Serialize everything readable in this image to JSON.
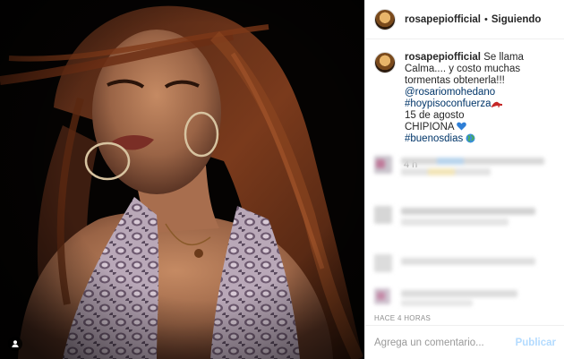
{
  "post": {
    "author": "rosapepiofficial",
    "separator": "•",
    "follow_status": "Siguiendo",
    "caption": {
      "username": "rosapepiofficial",
      "text_line1": "Se llama Calma.... y costo muchas tormentas obtenerla!!!",
      "mention": "@rosariomohedano",
      "hashtag1": "#hoypisoconfuerza",
      "date_line": "15 de agosto",
      "place": "CHIPIONA",
      "hashtag2": "#buenosdias"
    },
    "time_ago": "4 h",
    "post_date": "HACE 4 HORAS"
  },
  "comment_form": {
    "placeholder": "Agrega un comentario...",
    "publish_label": "Publicar"
  },
  "icons": {
    "user_tag": "user-tag-icon",
    "heel": "high-heel-emoji",
    "heart": "blue-heart-emoji",
    "globe": "globe-emoji"
  },
  "colors": {
    "link": "#003569",
    "muted": "#8e8e8e",
    "publish_disabled": "#b3dbff",
    "border": "#efefef"
  }
}
